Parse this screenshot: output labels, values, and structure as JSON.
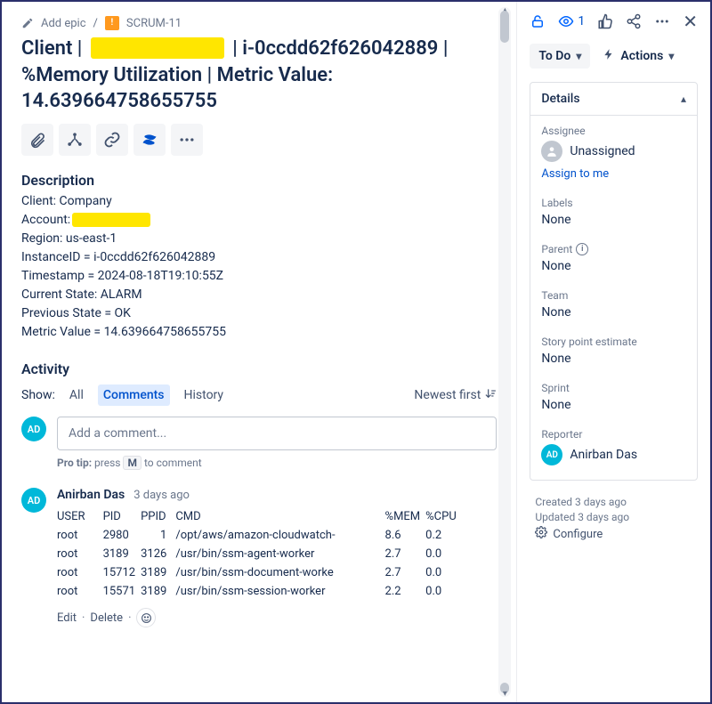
{
  "breadcrumb": {
    "add_epic": "Add epic",
    "issue_key": "SCRUM-11"
  },
  "title": {
    "prefix": "Client | ",
    "after_redact": " | i-0ccdd62f626042889 | %Memory Utilization | Metric Value: 14.639664758655755"
  },
  "description": {
    "heading": "Description",
    "client_label": "Client: Company",
    "account_label": "Account:",
    "region": "Region: us-east-1",
    "instance": "InstanceID = i-0ccdd62f626042889",
    "timestamp": "Timestamp = 2024-08-18T19:10:55Z",
    "current": "Current State: ALARM",
    "previous": "Previous State = OK",
    "metric": "Metric Value = 14.639664758655755"
  },
  "activity": {
    "heading": "Activity",
    "show_label": "Show:",
    "tab_all": "All",
    "tab_comments": "Comments",
    "tab_history": "History",
    "newest_first": "Newest first",
    "add_placeholder": "Add a comment...",
    "protip_pre": "Pro tip:",
    "protip_press": " press ",
    "protip_key": "M",
    "protip_post": " to comment",
    "avatar_initials": "AD",
    "comment": {
      "author": "Anirban Das",
      "time": "3 days ago",
      "headers": {
        "user": "USER",
        "pid": "PID",
        "ppid": "PPID",
        "cmd": "CMD",
        "mem": "%MEM",
        "cpu": "%CPU"
      },
      "rows": [
        {
          "user": "root",
          "pid": "2980",
          "ppid": "1",
          "cmd": "/opt/aws/amazon-cloudwatch-",
          "mem": "8.6",
          "cpu": "0.2"
        },
        {
          "user": "root",
          "pid": "3189",
          "ppid": "3126",
          "cmd": "/usr/bin/ssm-agent-worker",
          "mem": "2.7",
          "cpu": "0.0"
        },
        {
          "user": "root",
          "pid": "15712",
          "ppid": "3189",
          "cmd": "/usr/bin/ssm-document-worke",
          "mem": "2.7",
          "cpu": "0.0"
        },
        {
          "user": "root",
          "pid": "15571",
          "ppid": "3189",
          "cmd": "/usr/bin/ssm-session-worker",
          "mem": "2.2",
          "cpu": "0.0"
        }
      ],
      "edit": "Edit",
      "delete": "Delete"
    }
  },
  "side": {
    "watch_count": "1",
    "status": "To Do",
    "actions": "Actions",
    "details": "Details",
    "assignee_label": "Assignee",
    "assignee_value": "Unassigned",
    "assign_to_me": "Assign to me",
    "labels_label": "Labels",
    "labels_value": "None",
    "parent_label": "Parent",
    "parent_value": "None",
    "team_label": "Team",
    "team_value": "None",
    "story_label": "Story point estimate",
    "story_value": "None",
    "sprint_label": "Sprint",
    "sprint_value": "None",
    "reporter_label": "Reporter",
    "reporter_value": "Anirban Das",
    "reporter_initials": "AD",
    "created": "Created 3 days ago",
    "updated": "Updated 3 days ago",
    "configure": "Configure"
  }
}
